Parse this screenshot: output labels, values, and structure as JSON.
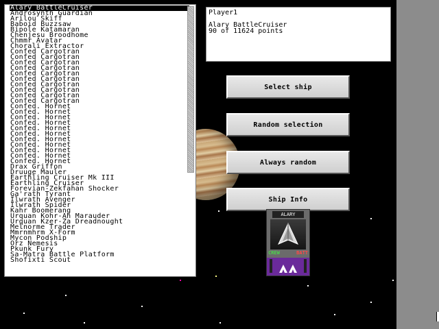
{
  "ships": [
    "Alary BattleCruiser",
    "Androsynth Guardian",
    "Arilou Skiff",
    "Baboid Buzzsaw",
    "Bipole Katamaran",
    "Chenjesu Broodhome",
    "Chmmr Avatar",
    "Chorali Extractor",
    "Confed Cargotran",
    "Confed Cargotran",
    "Confed Cargotran",
    "Confed Cargotran",
    "Confed Cargotran",
    "Confed Cargotran",
    "Confed Cargotran",
    "Confed Cargotran",
    "Confed Cargotran",
    "Confed Cargotran",
    "Confed. Hornet",
    "Confed. Hornet",
    "Confed. Hornet",
    "Confed. Hornet",
    "Confed. Hornet",
    "Confed. Hornet",
    "Confed. Hornet",
    "Confed. Hornet",
    "Confed. Hornet",
    "Confed. Hornet",
    "Confed. Hornet",
    "Drax Griffon",
    "Druuge Mauler",
    "Earthling Cruiser Mk III",
    "Earthling Cruiser",
    "Forevian-Zekfahan Shocker",
    "Ga'rath Tyrant",
    "Ilwrath Avenger",
    "Ilwrath Spider",
    "Kahr Boomerang",
    "Urquan Kohr-Ah Marauder",
    "Urquan Kzer-Za Dreadnought",
    "Melnorme Trader",
    "Mmrnmhrm X-Form",
    "Mycon Podship",
    "Orz Nemesis",
    "Pkunk Fury",
    "Sa-Matra Battle Platform",
    "Shofixti Scout"
  ],
  "selected_index": 0,
  "info": {
    "player": "Player1",
    "ship": "Alary BattleCruiser",
    "points": "90 of 11624 points"
  },
  "buttons": {
    "select": "Select ship",
    "random": "Random selection",
    "always_random": "Always random",
    "ship_info": "Ship Info"
  },
  "ship_card": {
    "name": "ALARY",
    "crew_label": "CREW",
    "batt_label": "BATT"
  }
}
